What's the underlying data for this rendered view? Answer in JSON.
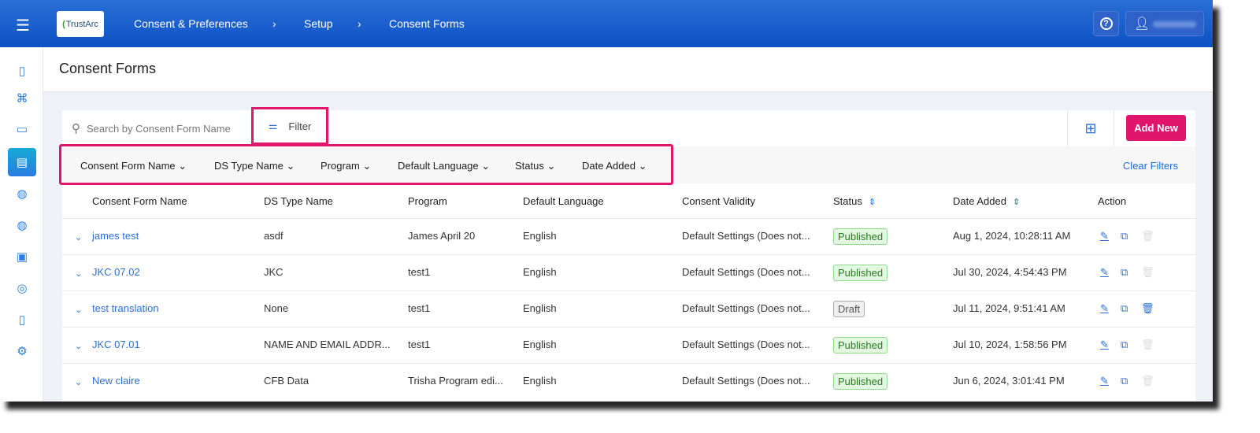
{
  "header": {
    "logo": "TrustArc",
    "breadcrumb": [
      "Consent & Preferences",
      "Setup",
      "Consent Forms"
    ]
  },
  "page_title": "Consent Forms",
  "toolbar": {
    "search_placeholder": "Search by Consent Form Name",
    "filter_label": "Filter",
    "add_new_label": "Add New"
  },
  "filters": {
    "items": [
      "Consent Form Name",
      "DS Type Name",
      "Program",
      "Default Language",
      "Status",
      "Date Added"
    ],
    "clear_label": "Clear Filters"
  },
  "table": {
    "columns": [
      "Consent Form Name",
      "DS Type Name",
      "Program",
      "Default Language",
      "Consent Validity",
      "Status",
      "Date Added",
      "Action"
    ],
    "rows": [
      {
        "name": "james test",
        "ds_type": "asdf",
        "program": "James April 20",
        "language": "English",
        "validity": "Default Settings (Does not...",
        "status": "Published",
        "date": "Aug 1, 2024, 10:28:11 AM"
      },
      {
        "name": "JKC 07.02",
        "ds_type": "JKC",
        "program": "test1",
        "language": "English",
        "validity": "Default Settings (Does not...",
        "status": "Published",
        "date": "Jul 30, 2024, 4:54:43 PM"
      },
      {
        "name": "test translation",
        "ds_type": "None",
        "program": "test1",
        "language": "English",
        "validity": "Default Settings (Does not...",
        "status": "Draft",
        "date": "Jul 11, 2024, 9:51:41 AM"
      },
      {
        "name": "JKC 07.01",
        "ds_type": "NAME AND EMAIL ADDR...",
        "program": "test1",
        "language": "English",
        "validity": "Default Settings (Does not...",
        "status": "Published",
        "date": "Jul 10, 2024, 1:58:56 PM"
      },
      {
        "name": "New claire",
        "ds_type": "CFB Data",
        "program": "Trisha Program edi...",
        "language": "English",
        "validity": "Default Settings (Does not...",
        "status": "Published",
        "date": "Jun 6, 2024, 3:01:41 PM"
      }
    ]
  }
}
